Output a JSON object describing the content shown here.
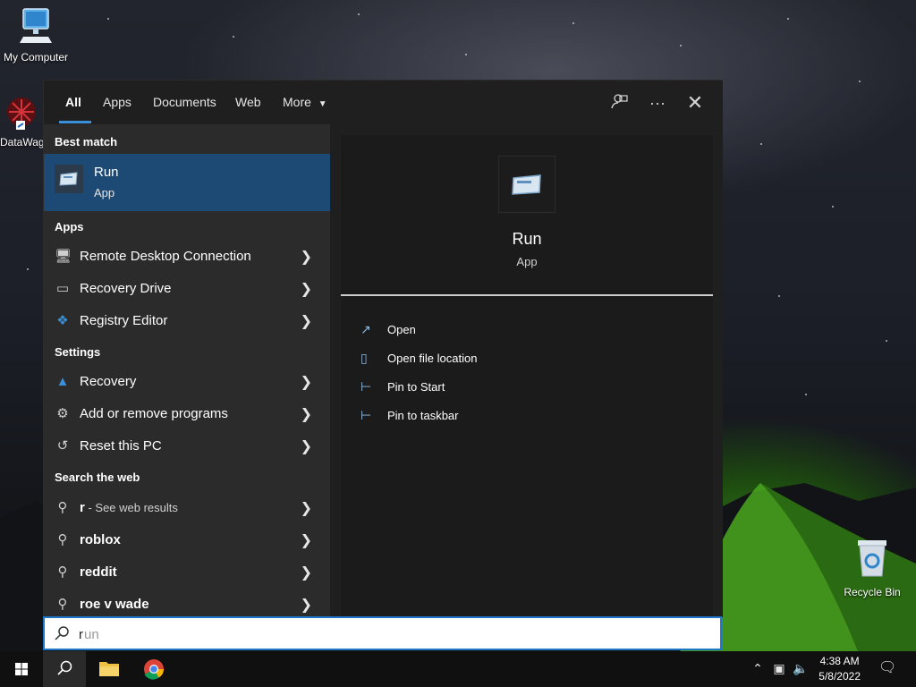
{
  "desktop": {
    "my_computer_label": "My Computer",
    "datawag_label": "DataWag",
    "recycle_bin_label": "Recycle Bin"
  },
  "tabs": [
    {
      "label": "All",
      "active": true
    },
    {
      "label": "Apps"
    },
    {
      "label": "Documents"
    },
    {
      "label": "Web"
    },
    {
      "label": "More"
    }
  ],
  "toolbar_icons": [
    "feedback-icon",
    "more-options-icon",
    "close-icon"
  ],
  "left": {
    "best_match_heading": "Best match",
    "best_match": {
      "title": "Run",
      "type": "App"
    },
    "apps_heading": "Apps",
    "apps": [
      {
        "label": "Remote Desktop Connection",
        "icon": "remote-desktop-icon"
      },
      {
        "label": "Recovery Drive",
        "icon": "drive-icon"
      },
      {
        "label": "Registry Editor",
        "icon": "registry-icon"
      }
    ],
    "settings_heading": "Settings",
    "settings": [
      {
        "label": "Recovery",
        "icon": "recovery-icon"
      },
      {
        "label": "Add or remove programs",
        "icon": "gear-icon"
      },
      {
        "label": "Reset this PC",
        "icon": "reset-pc-icon"
      }
    ],
    "web_heading": "Search the web",
    "web": {
      "query_prefix": "r",
      "query_suffix": " - See web results",
      "suggestions": [
        "roblox",
        "reddit",
        "roe v wade"
      ]
    }
  },
  "right": {
    "app_title": "Run",
    "app_type": "App",
    "actions": [
      {
        "label": "Open",
        "icon": "open-icon"
      },
      {
        "label": "Open file location",
        "icon": "file-location-icon"
      },
      {
        "label": "Pin to Start",
        "icon": "pin-icon"
      },
      {
        "label": "Pin to taskbar",
        "icon": "pin-icon"
      }
    ]
  },
  "search": {
    "value": "r",
    "placeholder": "run"
  },
  "taskbar": {
    "time": "4:38 AM",
    "date": "5/8/2022",
    "tray_icons": [
      "chevron-up-icon",
      "network-icon",
      "volume-icon"
    ],
    "notification_icon": "notification-icon"
  },
  "colors": {
    "selection": "#1d4a75",
    "accent": "#3a8fd6",
    "panel_bg": "#1f1f1f",
    "list_bg": "#2b2b2b"
  }
}
